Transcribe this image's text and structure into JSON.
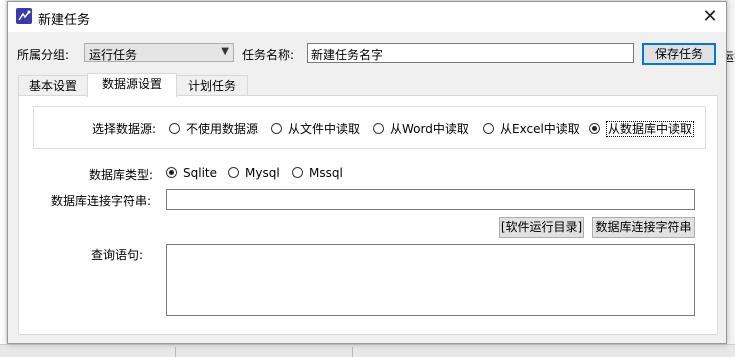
{
  "window": {
    "title": "新建任务",
    "close_glyph": "✕"
  },
  "background": {
    "clipped_text": "运行"
  },
  "header": {
    "group_label": "所属分组:",
    "group_value": "运行任务",
    "task_name_label": "任务名称:",
    "task_name_value": "新建任务名字",
    "save_button": "保存任务"
  },
  "tabs": [
    {
      "label": "基本设置",
      "active": false
    },
    {
      "label": "数据源设置",
      "active": true
    },
    {
      "label": "计划任务",
      "active": false
    }
  ],
  "data_source": {
    "label": "选择数据源:",
    "options": [
      {
        "label": "不使用数据源",
        "checked": false
      },
      {
        "label": "从文件中读取",
        "checked": false
      },
      {
        "label": "从Word中读取",
        "checked": false
      },
      {
        "label": "从Excel中读取",
        "checked": false
      },
      {
        "label": "从数据库中读取",
        "checked": true
      }
    ]
  },
  "database": {
    "type_label": "数据库类型:",
    "types": [
      {
        "label": "Sqlite",
        "checked": true
      },
      {
        "label": "Mysql",
        "checked": false
      },
      {
        "label": "Mssql",
        "checked": false
      }
    ],
    "conn_label": "数据库连接字符串:",
    "conn_value": "",
    "software_dir_button": "[软件运行目录]",
    "conn_string_button": "数据库连接字符串",
    "query_label": "查询语句:",
    "query_value": ""
  },
  "colors": {
    "accent": "#0078d7",
    "panel_bg": "#ffffff",
    "window_bg": "#f0f0f0"
  }
}
